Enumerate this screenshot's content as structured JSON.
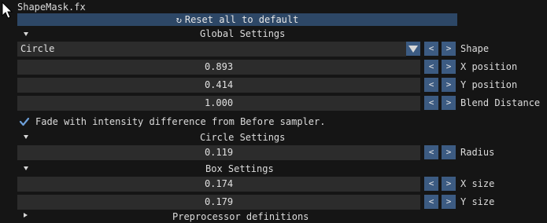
{
  "effect": {
    "title": "ShapeMask.fx"
  },
  "reset_button": {
    "label": "Reset all to default"
  },
  "sections": {
    "global": {
      "title": "Global Settings"
    },
    "circle": {
      "title": "Circle Settings"
    },
    "box": {
      "title": "Box Settings"
    },
    "partial": {
      "title": "Preprocessor definitions"
    }
  },
  "shape": {
    "label": "Shape",
    "selected": "Circle"
  },
  "x_position": {
    "label": "X position",
    "value": "0.893"
  },
  "y_position": {
    "label": "Y position",
    "value": "0.414"
  },
  "blend_distance": {
    "label": "Blend Distance",
    "value": "1.000"
  },
  "fade_checkbox": {
    "label": "Fade with intensity difference from Before sampler.",
    "checked": true
  },
  "radius": {
    "label": "Radius",
    "value": "0.119"
  },
  "x_size": {
    "label": "X size",
    "value": "0.174"
  },
  "y_size": {
    "label": "Y size",
    "value": "0.179"
  },
  "buttons": {
    "decrement": "<",
    "increment": ">"
  },
  "colors": {
    "accent": "#3c5b82",
    "reset_bar": "#2d4766",
    "field_bg": "#2c2c2c",
    "background": "#151515"
  },
  "icons": {
    "cursor": "mouse-cursor-icon",
    "reset": "reset-icon",
    "check": "check-icon"
  }
}
